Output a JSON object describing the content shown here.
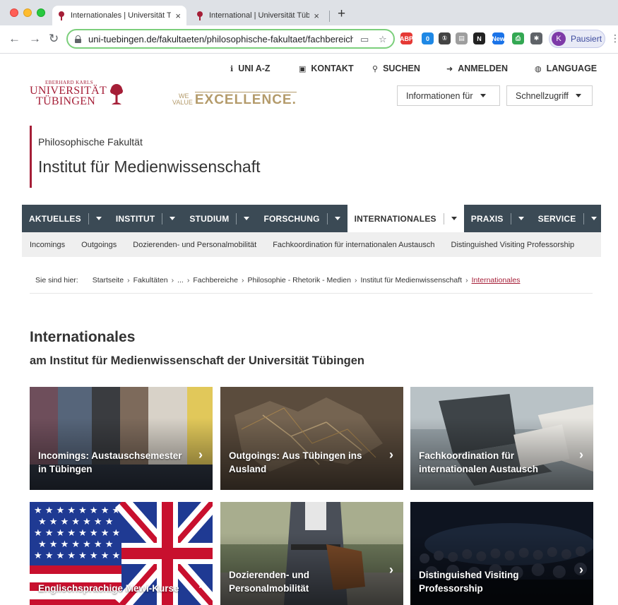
{
  "browser": {
    "tabs": [
      {
        "title": "Internationales | Universität Tü",
        "active": true
      },
      {
        "title": "International | Universität Tübin",
        "active": false
      }
    ],
    "new_tab_label": "+",
    "close_glyph": "×",
    "url": "uni-tuebingen.de/fakultaeten/philosophische-fakultaet/fachbereiche/",
    "profile_initial": "K",
    "profile_label": "Pausiert",
    "extensions": [
      {
        "name": "adblock-icon",
        "text": "ABP",
        "color": "#e53935"
      },
      {
        "name": "extension-badge-icon",
        "text": "0",
        "color": "#1e88e5"
      },
      {
        "name": "onepassword-icon",
        "text": "①",
        "color": "#444444"
      },
      {
        "name": "notes-icon",
        "text": "▤",
        "color": "#9e9e9e"
      },
      {
        "name": "notion-icon",
        "text": "N",
        "color": "#222222"
      },
      {
        "name": "new-extension-icon",
        "text": "New",
        "color": "#1a73e8"
      },
      {
        "name": "printer-icon",
        "text": "⎙",
        "color": "#34a853"
      },
      {
        "name": "puzzle-icon",
        "text": "✱",
        "color": "#5f6368"
      }
    ]
  },
  "header": {
    "util_links": [
      {
        "icon": "info-icon",
        "glyph": "ℹ",
        "label": "UNI A-Z"
      },
      {
        "icon": "contact-icon",
        "glyph": "▣",
        "label": "KONTAKT"
      },
      {
        "icon": "search-icon",
        "glyph": "⚲",
        "label": "SUCHEN"
      },
      {
        "icon": "login-icon",
        "glyph": "➜",
        "label": "ANMELDEN"
      },
      {
        "icon": "globe-icon",
        "glyph": "◍",
        "label": "LANGUAGE"
      }
    ],
    "logo": {
      "line1": "EBERHARD KARLS",
      "line2": "UNIVERSITÄT",
      "line3": "TÜBINGEN"
    },
    "excellence": {
      "we": "WE",
      "value": "VALUE",
      "excellence": "EXCELLENCE."
    },
    "dropdowns": [
      "Informationen für",
      "Schnellzugriff"
    ]
  },
  "title": {
    "faculty": "Philosophische Fakultät",
    "institute": "Institut für Medienwissenschaft"
  },
  "mainnav": [
    {
      "label": "AKTUELLES",
      "active": false
    },
    {
      "label": "INSTITUT",
      "active": false
    },
    {
      "label": "STUDIUM",
      "active": false
    },
    {
      "label": "FORSCHUNG",
      "active": false
    },
    {
      "label": "INTERNATIONALES",
      "active": true
    },
    {
      "label": "PRAXIS",
      "active": false
    },
    {
      "label": "SERVICE",
      "active": false
    }
  ],
  "subnav": [
    "Incomings",
    "Outgoings",
    "Dozierenden- und Personalmobilität",
    "Fachkoordination für internationalen Austausch",
    "Distinguished Visiting Professorship"
  ],
  "breadcrumb": {
    "label": "Sie sind hier:",
    "items": [
      "Startseite",
      "Fakultäten",
      "...",
      "Fachbereiche",
      "Philosophie - Rhetorik - Medien",
      "Institut für Medienwissenschaft"
    ],
    "current": "Internationales",
    "separator": "›"
  },
  "content": {
    "heading": "Internationales",
    "subheading": "am Institut für Medienwissenschaft der Universität Tübingen",
    "cards": [
      {
        "label": "Incomings: Austauschsemester in Tübingen"
      },
      {
        "label": "Outgoings: Aus Tübingen ins Ausland"
      },
      {
        "label": "Fachkoordination für internationalen Austausch"
      },
      {
        "label": "Englischsprachige Mewi-Kurse"
      },
      {
        "label": "Dozierenden- und Personalmobilität"
      },
      {
        "label": "Distinguished Visiting Professorship"
      }
    ],
    "chevron": "›"
  },
  "colors": {
    "brand": "#a51e37",
    "nav_bg": "#3b4a55",
    "gold": "#b49b6b"
  }
}
